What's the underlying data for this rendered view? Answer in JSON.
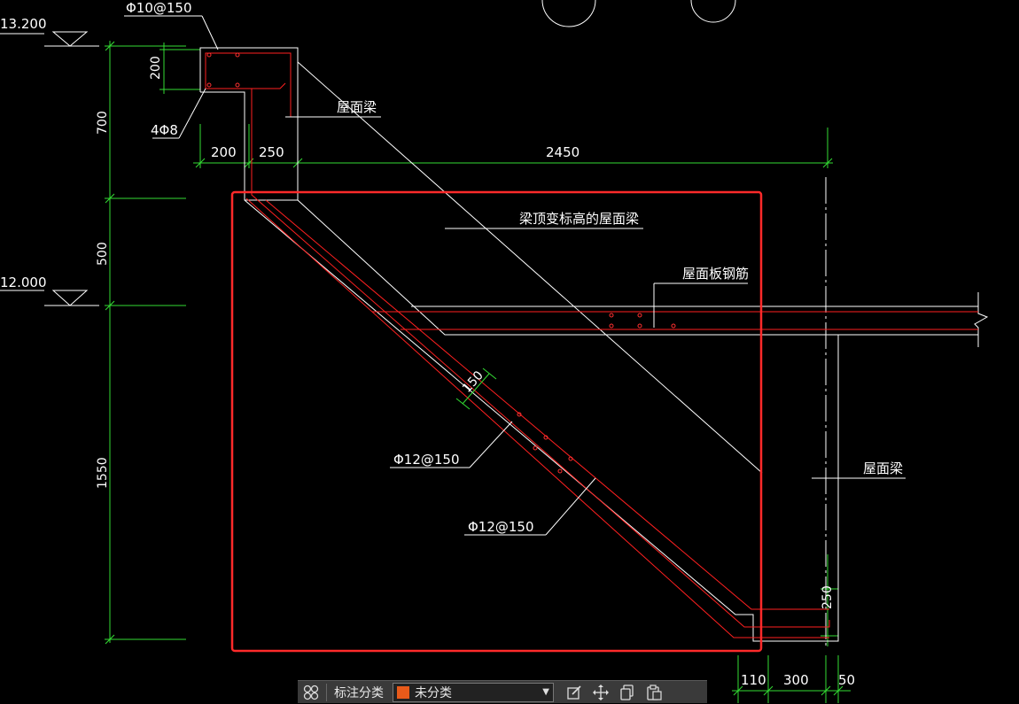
{
  "elevations": {
    "top": "13.200",
    "mid": "12.000"
  },
  "dims": {
    "v700": "700",
    "v500": "500",
    "v1550": "1550",
    "v200": "200",
    "h200": "200",
    "h250": "250",
    "h2450": "2450",
    "b110": "110",
    "b300": "300",
    "b50": "50",
    "r250": "250",
    "d150": "150"
  },
  "labels": {
    "stirrup_top": "Φ10@150",
    "bars_top": "4Φ8",
    "roof_beam_top": "屋面梁",
    "sloped_beam": "梁顶变标高的屋面梁",
    "slab_rebar": "屋面板钢筋",
    "rebar_a": "Φ12@150",
    "rebar_b": "Φ12@150",
    "roof_beam_right": "屋面梁"
  },
  "toolbar": {
    "category_label": "标注分类",
    "category_value": "未分类",
    "swatch_color": "#e85a1a"
  },
  "colors": {
    "dim": "#33dd33",
    "rebar": "#ff2020",
    "outline": "#ffffff",
    "highlight": "#ff2a2a"
  }
}
